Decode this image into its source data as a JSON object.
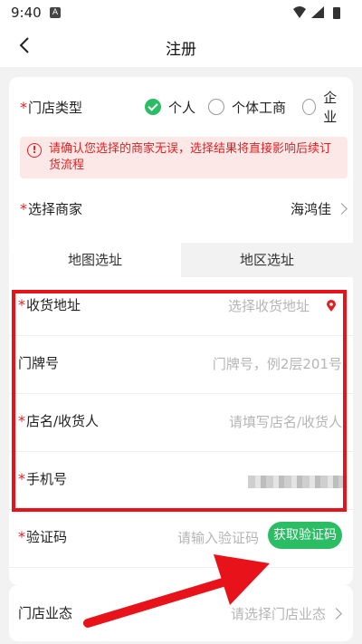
{
  "status_bar": {
    "time": "9:40",
    "app_badge": "A"
  },
  "header": {
    "title": "注册"
  },
  "store_type": {
    "label": "门店类型",
    "options": [
      {
        "label": "个人",
        "selected": true
      },
      {
        "label": "个体工商",
        "selected": false
      },
      {
        "label": "企业",
        "selected": false
      }
    ]
  },
  "warning": {
    "text": "请确认您选择的商家无误，选择结果将直接影响后续订货流程"
  },
  "merchant": {
    "label": "选择商家",
    "value": "海鸿佳"
  },
  "tabs": [
    {
      "label": "地图选址",
      "active": true
    },
    {
      "label": "地区选址",
      "active": false
    }
  ],
  "form": {
    "address": {
      "label": "收货地址",
      "placeholder": "选择收货地址"
    },
    "house_number": {
      "label": "门牌号",
      "placeholder": "门牌号，例2层201号"
    },
    "store_name": {
      "label": "店名/收货人",
      "placeholder": "请填写店名/收货人"
    },
    "phone": {
      "label": "手机号"
    },
    "code": {
      "label": "验证码",
      "placeholder": "请输入验证码",
      "button": "获取验证码"
    }
  },
  "business": {
    "label": "门店业态",
    "placeholder": "请选择门店业态"
  },
  "colors": {
    "accent": "#2bbd63",
    "required": "#e02020",
    "annotation": "#e8121a"
  }
}
